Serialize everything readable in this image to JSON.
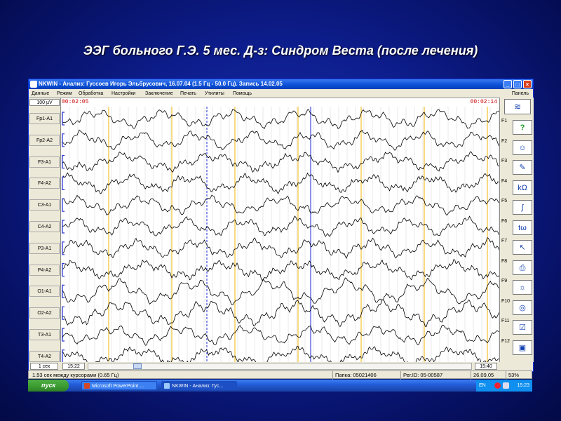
{
  "slide": {
    "title": "ЭЭГ больного Г.Э. 5 мес. Д-з: Синдром Веста (после лечения)"
  },
  "window": {
    "title": "NKWIN - Анализ: Гуссоев Игорь Эльбрусович, 16.07.04 (1.5 Гц - 50.0 Гц). Запись 14.02.05",
    "buttons": {
      "minimize": "_",
      "maximize": "□",
      "close": "×"
    }
  },
  "menu": {
    "items": [
      "Данные",
      "Режим",
      "Обработка",
      "Настройки",
      "Заключение",
      "Печать",
      "Утилиты",
      "Помощь"
    ],
    "panel": "Панель"
  },
  "eeg": {
    "scale": "100 µV",
    "time_left": "00:02:05",
    "time_right": "00:02:14",
    "channels": [
      "Fp1-A1",
      "Fp2-A2",
      "F3-A1",
      "F4-A2",
      "C3-A1",
      "C4-A2",
      "P3-A1",
      "P4-A2",
      "O1-A1",
      "O2-A2",
      "T3-A1",
      "T4-A2"
    ],
    "colors": {
      "trace": "#000000",
      "second_marker": "#f0b400",
      "cursor": "#1a2ad0",
      "grid": "#c8c8c8"
    }
  },
  "function_keys": [
    {
      "key": "F1",
      "icon": "help-icon",
      "glyph": "?"
    },
    {
      "key": "F2",
      "icon": "patient-face-icon",
      "glyph": "☺"
    },
    {
      "key": "F3",
      "icon": "pen-icon",
      "glyph": "✎"
    },
    {
      "key": "F4",
      "icon": "impedance-icon",
      "glyph": "kΩ"
    },
    {
      "key": "F5",
      "icon": "curve-icon",
      "glyph": "∫"
    },
    {
      "key": "F6",
      "icon": "time-frequency-icon",
      "glyph": "tω"
    },
    {
      "key": "F7",
      "icon": "cursor-icon",
      "glyph": "↖"
    },
    {
      "key": "F8",
      "icon": "printer-icon",
      "glyph": "⎙"
    },
    {
      "key": "F9",
      "icon": "lamp-icon",
      "glyph": "☼"
    },
    {
      "key": "F10",
      "icon": "globe-icon",
      "glyph": "◎"
    },
    {
      "key": "F11",
      "icon": "checklist-icon",
      "glyph": "☑"
    },
    {
      "key": "F12",
      "icon": "archive-icon",
      "glyph": "▣"
    }
  ],
  "bottom_bar": {
    "timebase": "1 сек",
    "position_left": "15:22",
    "position_right": "15:40"
  },
  "status_bar": {
    "cursor_info": "1.53 сек между курсорами (0.65 Гц)",
    "folder": "Папка: 05021406",
    "reg_id": "Рег.ID: 05-00587",
    "date": "26.09.05",
    "zoom": "53%"
  },
  "taskbar": {
    "start": "пуск",
    "tasks": [
      "Microsoft PowerPoint ...",
      "NKWIN - Анализ: Гус..."
    ],
    "language": "EN",
    "clock": "15:23"
  }
}
